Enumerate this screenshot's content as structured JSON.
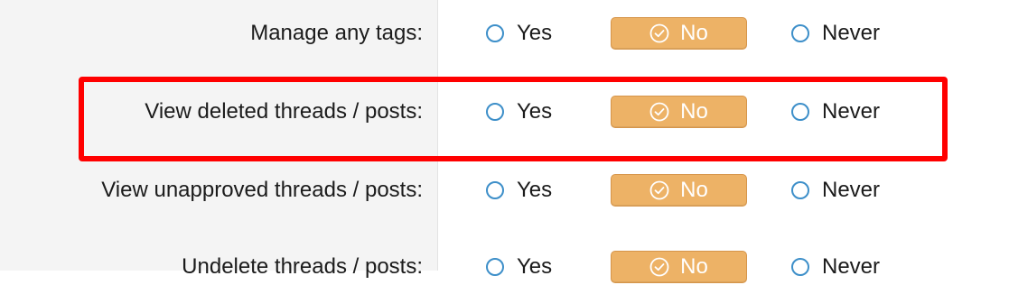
{
  "options": {
    "yes": "Yes",
    "no": "No",
    "never": "Never"
  },
  "rows": [
    {
      "label": "Manage any tags:",
      "selected": "No"
    },
    {
      "label": "View deleted threads / posts:",
      "selected": "No"
    },
    {
      "label": "View unapproved threads / posts:",
      "selected": "No"
    },
    {
      "label": "Undelete threads / posts:",
      "selected": "No"
    }
  ],
  "colors": {
    "selected_bg": "#edb266",
    "radio_border": "#3d8fc9",
    "highlight": "#ff0000"
  },
  "icons": {
    "selected_marker": "check-circle-icon",
    "unselected_marker": "radio-circle-icon"
  }
}
